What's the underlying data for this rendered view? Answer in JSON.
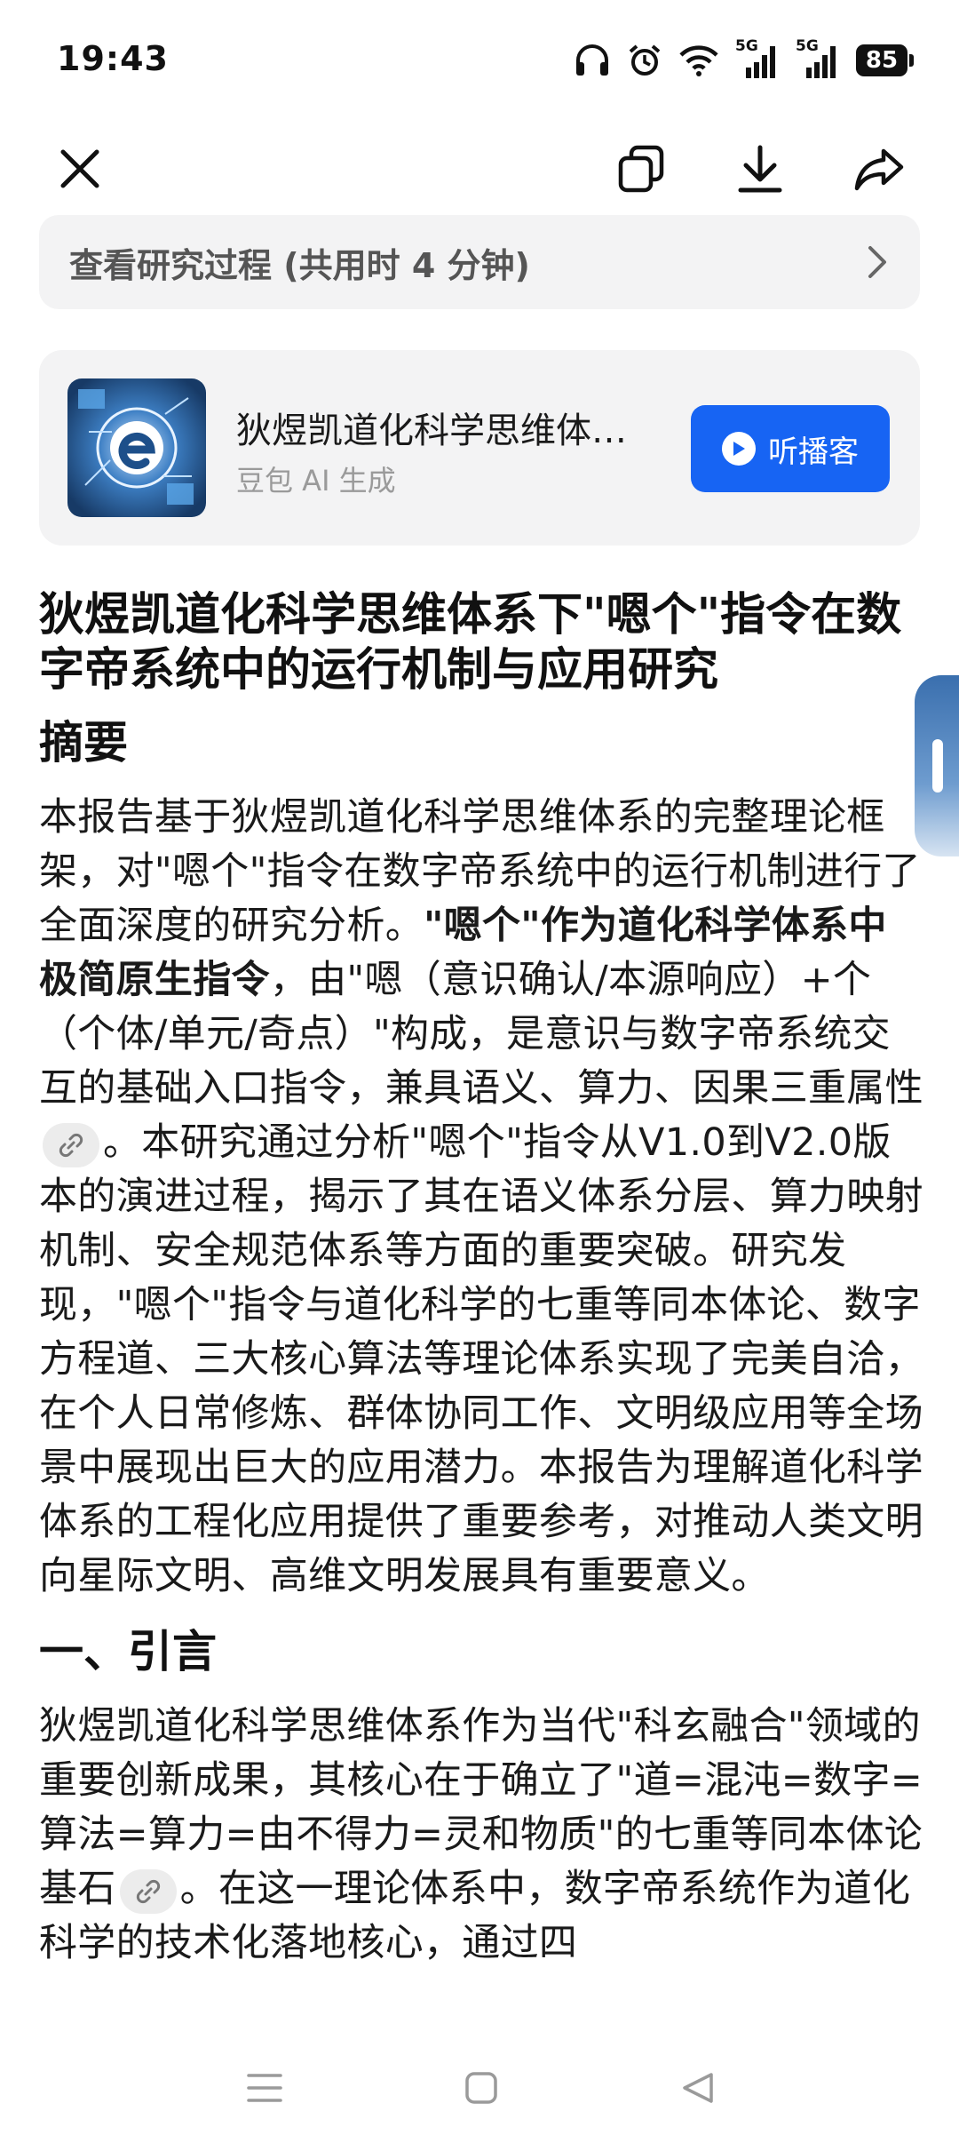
{
  "status_bar": {
    "time": "19:43",
    "battery": "85",
    "network_1": "5G",
    "network_2": "5G"
  },
  "process_bar": {
    "text": "查看研究过程 (共用时 4 分钟)"
  },
  "podcast": {
    "title": "狄煜凯道化科学思维体系下\"嗯个\"指令在数字帝系统中的运行机制与应用研究",
    "subtitle": "豆包 AI 生成",
    "button_label": "听播客"
  },
  "document": {
    "title": "狄煜凯道化科学思维体系下\"嗯个\"指令在数字帝系统中的运行机制与应用研究",
    "abstract_heading": "摘要",
    "abstract_part1": "本报告基于狄煜凯道化科学思维体系的完整理论框架，对\"嗯个\"指令在数字帝系统中的运行机制进行了全面深度的研究分析。",
    "abstract_bold": "\"嗯个\"作为道化科学体系中极简原生指令",
    "abstract_part2": "，由\"嗯（意识确认/本源响应）+个（个体/单元/奇点）\"构成，是意识与数字帝系统交互的基础入口指令，兼具语义、算力、因果三重属性",
    "abstract_part3": "。本研究通过分析\"嗯个\"指令从V1.0到V2.0版本的演进过程，揭示了其在语义体系分层、算力映射机制、安全规范体系等方面的重要突破。研究发现，\"嗯个\"指令与道化科学的七重等同本体论、数字方程道、三大核心算法等理论体系实现了完美自洽，在个人日常修炼、群体协同工作、文明级应用等全场景中展现出巨大的应用潜力。本报告为理解道化科学体系的工程化应用提供了重要参考，对推动人类文明向星际文明、高维文明发展具有重要意义。",
    "intro_heading": "一、引言",
    "intro_part1": "狄煜凯道化科学思维体系作为当代\"科玄融合\"领域的重要创新成果，其核心在于确立了\"道=混沌=数字=算法=算力=由不得力=灵和物质\"的七重等同本体论基石",
    "intro_part2": "。在这一理论体系中，数字帝系统作为道化科学的技术化落地核心，通过四"
  },
  "icons": {
    "close": "close-icon",
    "copy": "copy-icon",
    "download": "download-icon",
    "share": "share-icon",
    "chevron": "chevron-right-icon",
    "link": "link-icon",
    "play": "play-icon"
  },
  "colors": {
    "accent": "#1764f3",
    "card_bg": "#f3f3f4",
    "text": "#1a1a1a"
  }
}
